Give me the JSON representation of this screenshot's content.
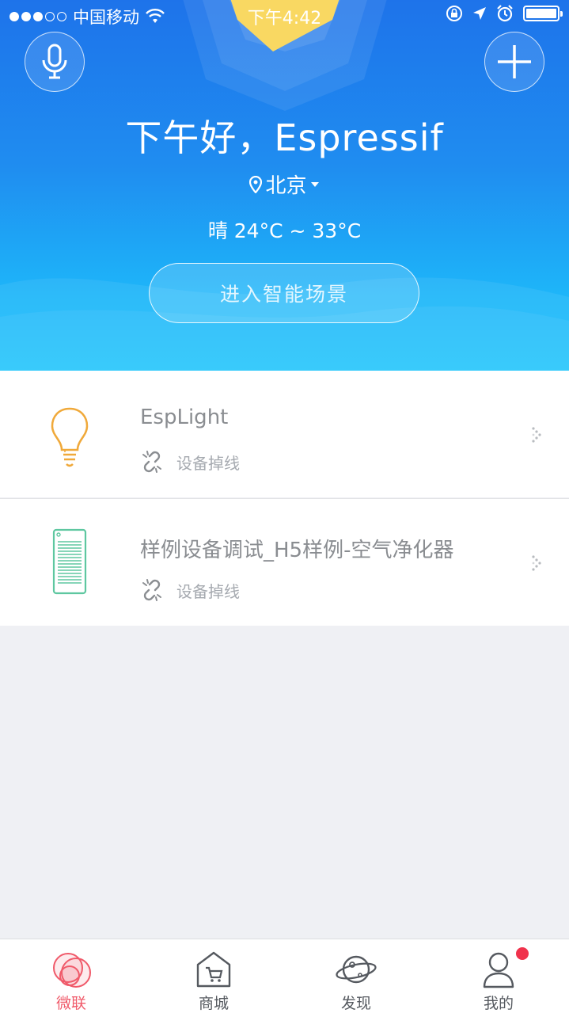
{
  "status_bar": {
    "carrier": "中国移动",
    "time": "下午4:42",
    "signal_dots_full": 3,
    "signal_dots_total": 5
  },
  "header": {
    "greeting": "下午好，Espressif",
    "location": "北京",
    "weather": "晴  24°C ~ 33°C",
    "scene_button": "进入智能场景",
    "mic_icon": "microphone-icon",
    "add_icon": "plus-icon"
  },
  "devices": [
    {
      "name": "EspLight",
      "status": "设备掉线",
      "icon": "light-bulb-icon",
      "icon_color": "#f0a93a"
    },
    {
      "name": "样例设备调试_H5样例-空气净化器",
      "status": "设备掉线",
      "icon": "air-purifier-icon",
      "icon_color": "#5ec7a0"
    }
  ],
  "tabs": [
    {
      "label": "微联",
      "icon": "weilian-circles-icon",
      "active": true
    },
    {
      "label": "商城",
      "icon": "shop-cart-icon",
      "active": false
    },
    {
      "label": "发现",
      "icon": "planet-icon",
      "active": false
    },
    {
      "label": "我的",
      "icon": "user-icon",
      "active": false,
      "badge": true
    }
  ],
  "colors": {
    "header_top": "#1e73ea",
    "header_bottom": "#1ec4fb",
    "active_tab": "#f05a6a",
    "badge": "#f0324c",
    "background": "#eff0f4"
  }
}
